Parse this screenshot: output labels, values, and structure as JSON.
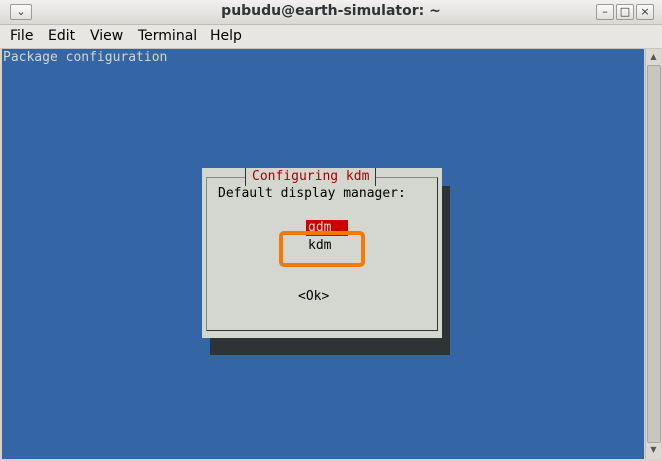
{
  "window": {
    "title": "pubudu@earth-simulator: ~"
  },
  "menubar": {
    "items": [
      "File",
      "Edit",
      "View",
      "Terminal",
      "Help"
    ]
  },
  "terminal": {
    "header_text": "Package configuration"
  },
  "dialog": {
    "title": "Configuring kdm",
    "prompt": "Default display manager:",
    "options": [
      "gdm",
      "kdm"
    ],
    "selected_option": "gdm",
    "ok_label": "<Ok>"
  },
  "colors": {
    "terminal_bg": "#3465a4",
    "dialog_bg": "#d3d7cf",
    "selection": "#cc0000",
    "annotation": "#f57900"
  }
}
